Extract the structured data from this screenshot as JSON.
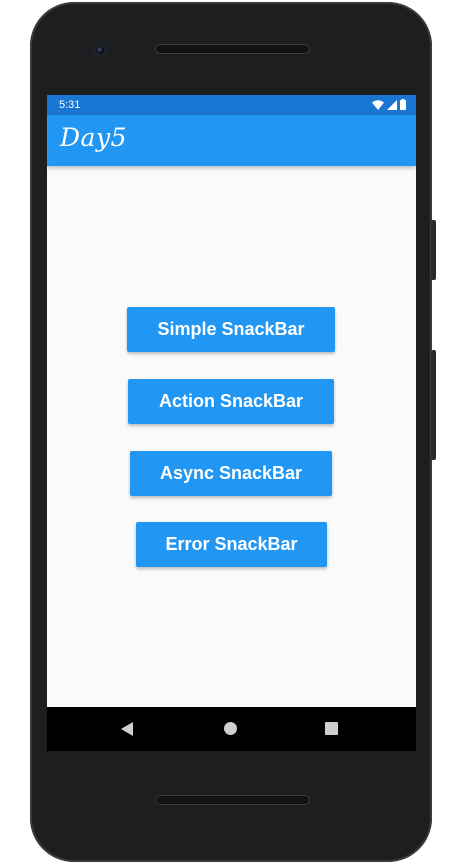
{
  "status_bar": {
    "time": "5:31",
    "icons": [
      "wifi-icon",
      "cell-signal-icon",
      "battery-icon"
    ]
  },
  "app_bar": {
    "title": "Day5",
    "background": "#2196f3"
  },
  "buttons": {
    "simple": "Simple SnackBar",
    "action": "Action SnackBar",
    "async": "Async SnackBar",
    "error": "Error SnackBar"
  },
  "navigation": {
    "items": [
      "back-icon",
      "home-icon",
      "recents-icon"
    ]
  },
  "colors": {
    "primary": "#2196f3",
    "primary_dark": "#1976d2",
    "background": "#fafafa"
  }
}
